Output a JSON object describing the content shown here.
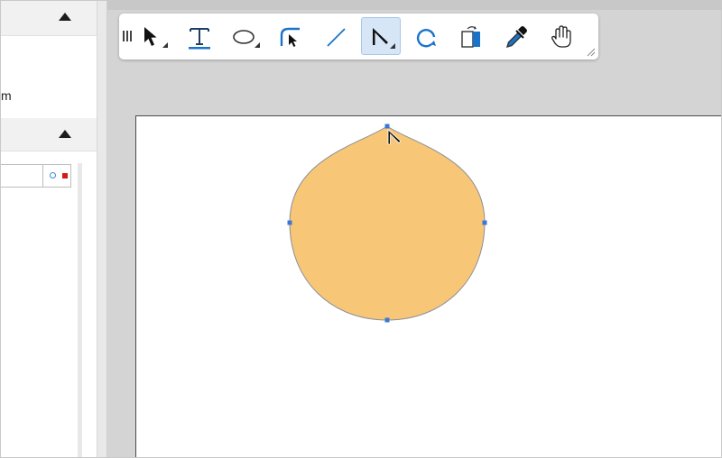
{
  "left_panel": {
    "visible_text": "m"
  },
  "toolbar": {
    "tools": [
      {
        "name": "selection-tool",
        "icon": "arrow-pointer-icon",
        "active": false
      },
      {
        "name": "text-tool",
        "icon": "text-icon",
        "active": false
      },
      {
        "name": "ellipse-tool",
        "icon": "ellipse-icon",
        "active": false
      },
      {
        "name": "node-curve-tool",
        "icon": "curve-node-icon",
        "active": false
      },
      {
        "name": "line-tool",
        "icon": "line-icon",
        "active": false
      },
      {
        "name": "node-edit-tool",
        "icon": "node-edit-icon",
        "active": true
      },
      {
        "name": "rotate-tool",
        "icon": "rotate-icon",
        "active": false
      },
      {
        "name": "gradient-tool",
        "icon": "gradient-icon",
        "active": false
      },
      {
        "name": "eyedropper-tool",
        "icon": "eyedropper-icon",
        "active": false
      },
      {
        "name": "pan-tool",
        "icon": "hand-icon",
        "active": false
      }
    ]
  },
  "colors": {
    "accent": "#1a73c9",
    "shape_fill": "#f8c677",
    "shape_stroke": "#8a8f96",
    "handle": "#3a78d8",
    "active_tool_bg": "#d7e6f7",
    "field_circle": "#3b8ad8",
    "field_square": "#d41a1a"
  }
}
